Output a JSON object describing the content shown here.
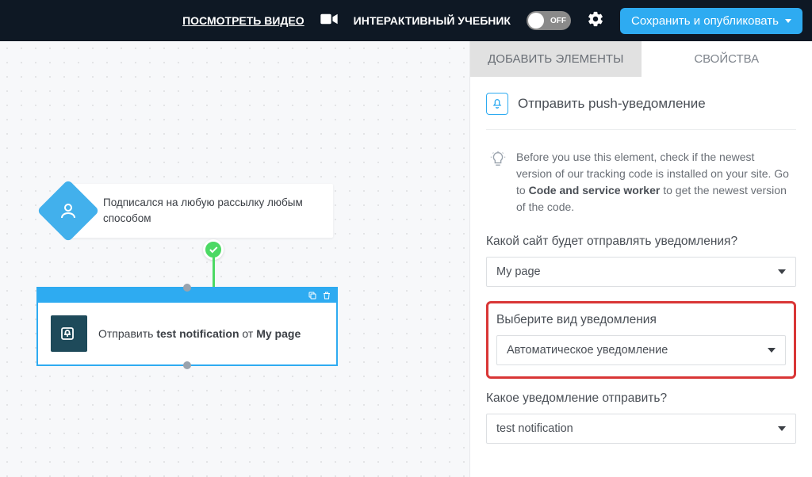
{
  "header": {
    "video_link": "ПОСМОТРЕТЬ ВИДЕО",
    "tutorial_label": "ИНТЕРАКТИВНЫЙ УЧЕБНИК",
    "toggle_state": "OFF",
    "publish_label": "Сохранить и опубликовать"
  },
  "canvas": {
    "trigger_text": "Подписался на любую рассылку любым способом",
    "action_prefix": "Отправить ",
    "action_notification": "test notification",
    "action_mid": " от ",
    "action_page": "My page"
  },
  "panel": {
    "tabs": {
      "add": "ДОБАВИТЬ ЭЛЕМЕНТЫ",
      "properties": "СВОЙСТВА"
    },
    "element_title": "Отправить push-уведомление",
    "hint_pre": "Before you use this element, check if the newest version of our tracking code is installed on your site. Go to ",
    "hint_bold": "Code and service worker",
    "hint_post": " to get the newest version of the code.",
    "fields": {
      "site_label": "Какой сайт будет отправлять уведомления?",
      "site_value": "My page",
      "type_label": "Выберите вид уведомления",
      "type_value": "Автоматическое уведомление",
      "which_label": "Какое уведомление отправить?",
      "which_value": "test notification"
    }
  }
}
